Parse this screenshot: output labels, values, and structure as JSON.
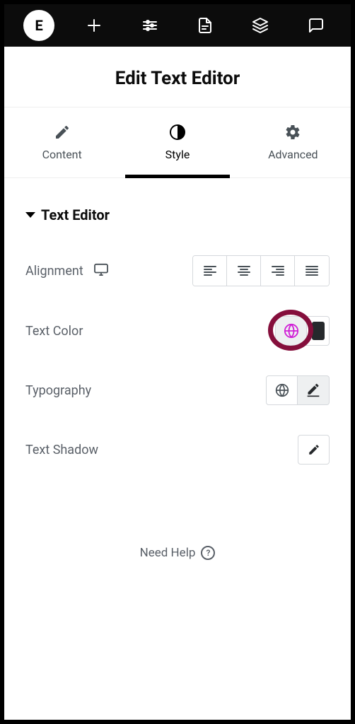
{
  "logo_letter": "E",
  "page_title": "Edit Text Editor",
  "tabs": {
    "content": {
      "label": "Content"
    },
    "style": {
      "label": "Style"
    },
    "advanced": {
      "label": "Advanced"
    }
  },
  "section": {
    "title": "Text Editor"
  },
  "controls": {
    "alignment": {
      "label": "Alignment"
    },
    "text_color": {
      "label": "Text Color",
      "swatch": "#26292c",
      "globe_color": "#d020d6"
    },
    "typography": {
      "label": "Typography"
    },
    "text_shadow": {
      "label": "Text Shadow"
    }
  },
  "help": {
    "label": "Need Help",
    "glyph": "?"
  }
}
